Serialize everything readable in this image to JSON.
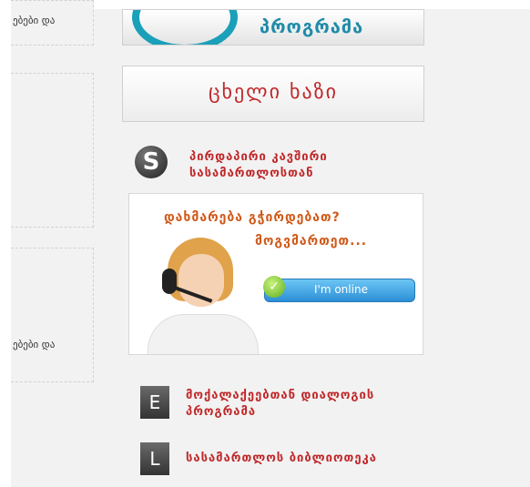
{
  "left_column": {
    "snippet_top": "ებები და",
    "snippet_bottom": "ებები და"
  },
  "sidebar": {
    "program_banner": {
      "text": "პროგრამა",
      "accent": "#1aa0b8"
    },
    "hotline": {
      "text": "ცხელი ხაზი",
      "color": "#c0282a"
    },
    "skype_link": {
      "icon": "skype-icon",
      "line1": "პირდაპირი კავშირი",
      "line2": "სასამართლოსთან"
    },
    "help_panel": {
      "question": "დახმარება გჭირდებათ?",
      "answer": "მოგვმართეთ...",
      "online_button": "I'm online"
    },
    "links": [
      {
        "letter": "E",
        "line1": "მოქალაქეებთან დიალოგის",
        "line2": "პროგრამა"
      },
      {
        "letter": "L",
        "line1": "სასამართლოს ბიბლიოთეკა"
      }
    ]
  }
}
